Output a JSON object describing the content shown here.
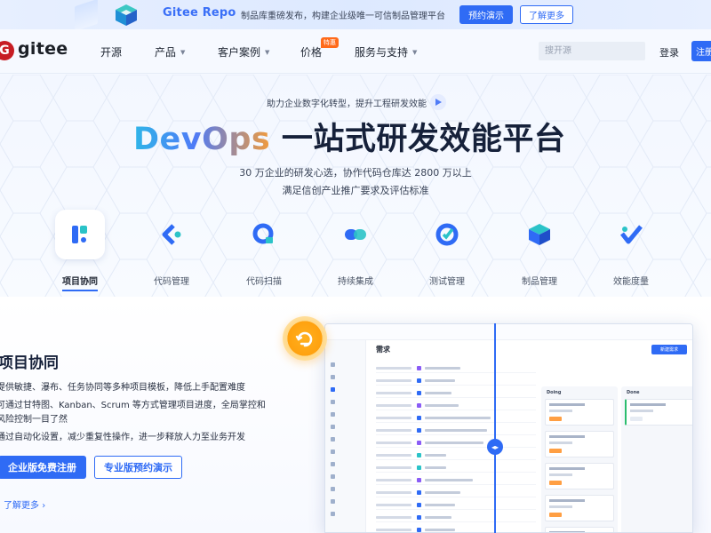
{
  "banner": {
    "title": "Gitee Repo",
    "subtitle": "制品库重磅发布，构建企业级唯一可信制品管理平台",
    "demo_button": "预约演示",
    "more_button": "了解更多"
  },
  "nav": {
    "logo_text": "gitee",
    "logo_letter": "G",
    "items": [
      {
        "label": "开源",
        "caret": false
      },
      {
        "label": "产品",
        "caret": true
      },
      {
        "label": "客户案例",
        "caret": true
      },
      {
        "label": "价格",
        "caret": false
      },
      {
        "label": "服务与支持",
        "caret": true
      }
    ],
    "hot_badge": "特惠",
    "search_placeholder": "搜开源",
    "login": "登录",
    "register": "注册"
  },
  "hero": {
    "tagline": "助力企业数字化转型，提升工程研发效能",
    "headline_devops": "DevOps",
    "headline_rest": " 一站式研发效能平台",
    "sub_line1": "30 万企业的研发心选，协作代码仓库达 2800 万以上",
    "sub_line2": "满足信创产业推广要求及评估标准"
  },
  "tabs": [
    {
      "label": "项目协同",
      "icon": "project-collab-icon",
      "active": true
    },
    {
      "label": "代码管理",
      "icon": "code-manage-icon",
      "active": false
    },
    {
      "label": "代码扫描",
      "icon": "code-scan-icon",
      "active": false
    },
    {
      "label": "持续集成",
      "icon": "ci-icon",
      "active": false
    },
    {
      "label": "测试管理",
      "icon": "test-manage-icon",
      "active": false
    },
    {
      "label": "制品管理",
      "icon": "artifact-manage-icon",
      "active": false
    },
    {
      "label": "效能度量",
      "icon": "metrics-icon",
      "active": false
    }
  ],
  "section": {
    "title": "项目协同",
    "desc_lines": [
      "提供敏捷、瀑布、任务协同等多种项目模板，降低上手配置难度",
      "可通过甘特图、Kanban、Scrum 等方式管理项目进度，全局掌控和",
      "风险控制一目了然",
      "通过自动化设置，减少重复性操作，进一步释放人力至业务开发"
    ],
    "enterprise_button": "企业版免费注册",
    "pro_button": "专业版预约演示",
    "learn_more": "了解更多"
  },
  "mock": {
    "title": "需求",
    "new_button": "新建需求",
    "columns": [
      "Doing",
      "Done"
    ]
  },
  "colors": {
    "primary": "#2f6bf5",
    "brand_red": "#c71d23",
    "hot_orange": "#ff6a1a",
    "text_dark": "#16213a"
  }
}
